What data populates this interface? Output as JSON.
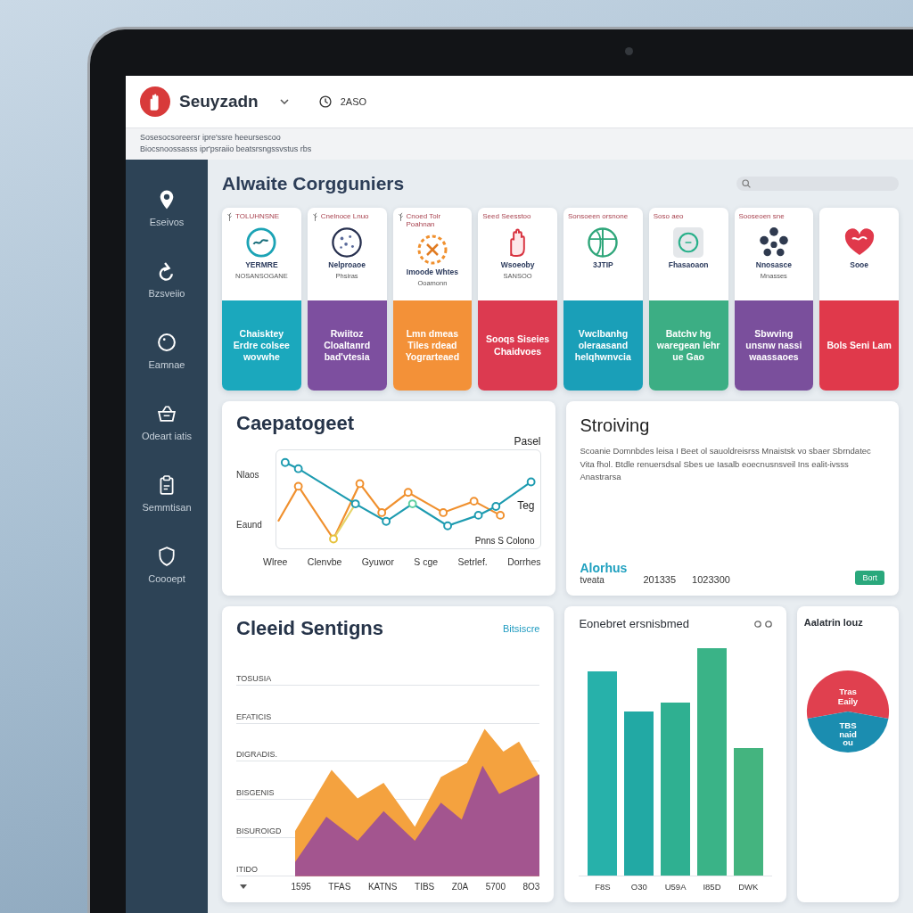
{
  "header": {
    "app_name": "Seuyzadn",
    "status": "2ASO",
    "notices": [
      "Sosesocsoreersr ipre'ssre heeursescoo",
      "Biocsnoossasss ipr'psraiio beatsrsngssvstus rbs"
    ]
  },
  "sidebar": {
    "items": [
      "Eseivos",
      "Bzsveiio",
      "Eamnae",
      "Odeart iatis",
      "Semmtisan",
      "Coooept"
    ]
  },
  "main": {
    "title": "Alwaite Corgguniers"
  },
  "cards": [
    {
      "header": "TOLUHNSNE",
      "caption": "YERMRE",
      "note": "NOSANSOGANE",
      "body": "Chaisktey Erdre colsee wovwhe",
      "color": "#1ba8bd"
    },
    {
      "header": "Cnelnoce Lnuo",
      "caption": "Nelproaoe",
      "note": "Phsiras",
      "body": "Rwiitoz Cloaltanrd bad'vtesia",
      "color": "#7d4f9f"
    },
    {
      "header": "Cnoed Tolr Poahnan",
      "caption": "Imoode Whtes",
      "note": "Ooamonn",
      "body": "Lmn dmeas Tiles rdead Yograrteaed",
      "color": "#f39138"
    },
    {
      "header": "Seed Seesstoo",
      "caption": "Wsoeoby",
      "note": "SANSOO",
      "body": "Sooqs Siseies Chaidvoes",
      "color": "#dc3a50"
    },
    {
      "header": "Sonsoeen orsnone",
      "caption": "3JTIP",
      "body": "Vwclbanhg oleraasand helqhwnvcia",
      "color": "#1a9fb8"
    },
    {
      "header": "Soso aeo",
      "caption": "Fhasaoaon",
      "body": "Batchv hg waregean lehr ue Gao",
      "color": "#3cae84"
    },
    {
      "header": "Sooseoen sne",
      "caption": "Nnosasce",
      "note": "Mnasses",
      "body": "Sbwving unsnw nassi waassaoes",
      "color": "#7a4f9c"
    },
    {
      "caption": "Sooe",
      "body": "Bols Seni Lam",
      "color": "#e0394b"
    }
  ],
  "trend_panel": {
    "title": "Caepatogeet",
    "legend_top": "Pasel",
    "y_labels": [
      "Nlaos",
      "Eaund"
    ],
    "side_label": "Teg",
    "legend_bottom": "Pnns S Colono",
    "x_labels": [
      "Wlree",
      "Clenvbe",
      "Gyuwor",
      "S cge",
      "Setrlef.",
      "Dorrhes"
    ]
  },
  "summary_panel": {
    "title": "Stroiving",
    "text": "Scoanie Domnbdes leisa I Beet ol sauoldreisrss Mnaistsk vo sbaer Sbrndatec Vita fhol. Btdle renuersdsal Sbes ue Iasalb eoecnusnsveil Ins ealit-ivsss Anastrarsa",
    "stat_label": "Alorhus",
    "stat_note": "tveata",
    "figures": [
      "201335",
      "1023300"
    ],
    "button": "Bort"
  },
  "area_panel": {
    "title": "Cleeid Sentigns",
    "link": "Bitsiscre",
    "y_labels": [
      "TOSUSIA",
      "EFATICIS",
      "DIGRADIS.",
      "BISGENIS",
      "BISUROIGD",
      "ITIDO"
    ],
    "x_labels": [
      "1595",
      "TFAS",
      "KATNS",
      "TIBS",
      "Z0A",
      "5700",
      "8O3"
    ]
  },
  "bar_panel": {
    "title": "Eonebret ersnisbmed",
    "x_labels": [
      "F8S",
      "O30",
      "U59A",
      "I85D",
      "DWK"
    ]
  },
  "pie_panel": {
    "title": "Aalatrin louz",
    "slices": [
      {
        "color": "#e0404f",
        "labels": [
          "Tras",
          "Eaily"
        ]
      },
      {
        "color": "#1b8db0",
        "labels": [
          "TBS",
          "naid",
          "ou"
        ]
      }
    ]
  }
}
